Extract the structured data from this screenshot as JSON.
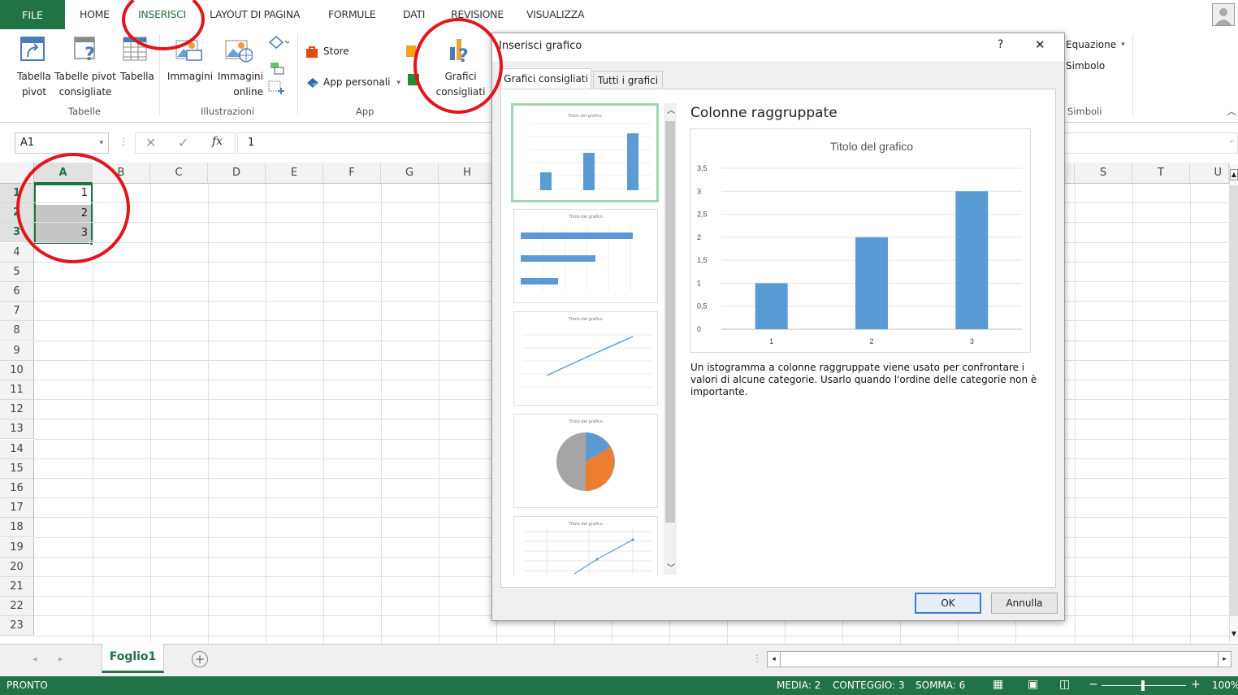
{
  "menu": {
    "file": "FILE",
    "tabs": [
      "HOME",
      "INSERISCI",
      "LAYOUT DI PAGINA",
      "FORMULE",
      "DATI",
      "REVISIONE",
      "VISUALIZZA"
    ],
    "active": "INSERISCI"
  },
  "ribbon": {
    "tabella_pivot": [
      "Tabella",
      "pivot"
    ],
    "tabelle_pivot_consigliate": [
      "Tabelle pivot",
      "consigliate"
    ],
    "tabella": "Tabella",
    "immagini": "Immagini",
    "immagini_online": [
      "Immagini",
      "online"
    ],
    "store": "Store",
    "app_personali": "App personali",
    "grafici_consigliati": [
      "Grafici",
      "consigliati"
    ],
    "equazione": "Equazione",
    "simbolo": "Simbolo",
    "groups": {
      "tabelle": "Tabelle",
      "illustrazioni": "Illustrazioni",
      "app": "App",
      "simboli": "Simboli"
    }
  },
  "formula_bar": {
    "name_box": "A1",
    "fx": "fx",
    "value": "1"
  },
  "grid": {
    "columns": [
      "A",
      "B",
      "C",
      "D",
      "E",
      "F",
      "G",
      "H",
      "S",
      "T",
      "U"
    ],
    "rows": [
      "1",
      "2",
      "3",
      "4",
      "5",
      "6",
      "7",
      "8",
      "9",
      "10",
      "11",
      "12",
      "13",
      "14",
      "15",
      "16",
      "17",
      "18",
      "19",
      "20",
      "21",
      "22",
      "23"
    ],
    "cells": {
      "A1": "1",
      "A2": "2",
      "A3": "3"
    }
  },
  "sheet": {
    "tab": "Foglio1"
  },
  "status": {
    "ready": "PRONTO",
    "media": "MEDIA: 2",
    "conteggio": "CONTEGGIO: 3",
    "somma": "SOMMA: 6",
    "zoom": "100%"
  },
  "dialog": {
    "title": "Inserisci grafico",
    "help": "?",
    "close": "✕",
    "tabs": [
      "Grafici consigliati",
      "Tutti i grafici"
    ],
    "chart_name": "Colonne raggruppate",
    "description": "Un istogramma a colonne raggruppate viene usato per confrontare i valori di alcune categorie. Usarlo quando l'ordine delle categorie non è importante.",
    "thumb_title": "Titolo del grafico",
    "ok": "OK",
    "cancel": "Annulla"
  },
  "chart_data": {
    "type": "bar",
    "title": "Titolo del grafico",
    "categories": [
      "1",
      "2",
      "3"
    ],
    "values": [
      1,
      2,
      3
    ],
    "ylim": [
      0,
      3.5
    ],
    "yticks": [
      "0",
      "0,5",
      "1",
      "1,5",
      "2",
      "2,5",
      "3",
      "3,5"
    ],
    "color": "#5b9bd5",
    "grid": true
  },
  "colors": {
    "excel_green": "#217346",
    "annotation_red": "#e3141b",
    "chart_blue": "#5b9bd5",
    "pie_orange": "#ed7d31",
    "pie_gray": "#a5a5a5"
  }
}
